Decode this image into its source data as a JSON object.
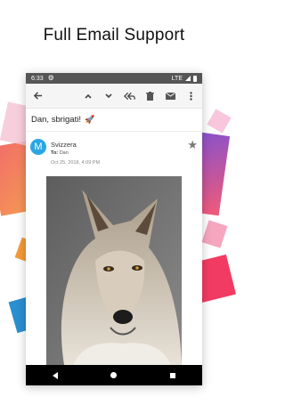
{
  "promo": {
    "title": "Full Email Support"
  },
  "status_bar": {
    "time": "6:33",
    "network": "LTE"
  },
  "toolbar": {
    "back_icon": "arrow-left-icon",
    "prev_icon": "chevron-up-icon",
    "next_icon": "chevron-down-icon",
    "reply_all_icon": "reply-all-icon",
    "delete_icon": "trash-icon",
    "mark_unread_icon": "envelope-icon",
    "more_icon": "more-vertical-icon"
  },
  "email": {
    "subject": "Dan, sbrigati!",
    "subject_emoji": "🚀",
    "sender": {
      "avatar_letter": "M",
      "avatar_color": "#2aa7e2",
      "name": "Svizzera",
      "to_label": "To:",
      "to_value": "Dan",
      "date": "Oct 25, 2018, 4:09 PM"
    },
    "attachment_image": "wolf-photo"
  },
  "nav_bar": {
    "back": "nav-back-icon",
    "home": "nav-home-icon",
    "recents": "nav-recents-icon"
  }
}
